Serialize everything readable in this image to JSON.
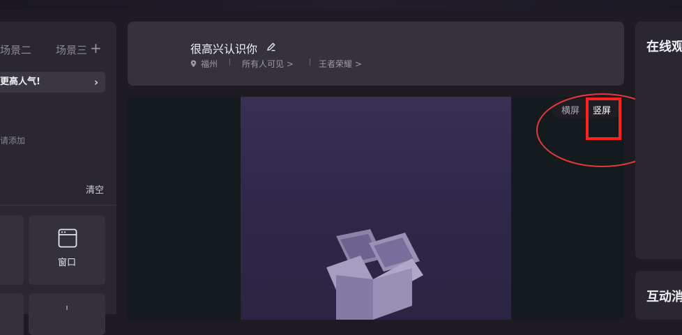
{
  "left_panel": {
    "scene_tabs": [
      "场景二",
      "场景三"
    ],
    "add_scene_symbol": "+",
    "promo_text": "更高人气!",
    "hint_text": "请添加",
    "clear_label": "清空",
    "tools": [
      {
        "label": "窗口",
        "icon": "window-icon"
      }
    ]
  },
  "header": {
    "title": "很高兴认识你",
    "location": "福州",
    "visibility": "所有人可见 >",
    "game": "王者荣耀 >"
  },
  "orientation": {
    "landscape_label": "横屏",
    "portrait_label": "竖屏",
    "selected": "portrait"
  },
  "right_panel": {
    "online_title": "在线观众",
    "interact_title": "互动消息"
  },
  "colors": {
    "annotation_red": "#ff2020",
    "preview_purple": "#3a2f55"
  }
}
